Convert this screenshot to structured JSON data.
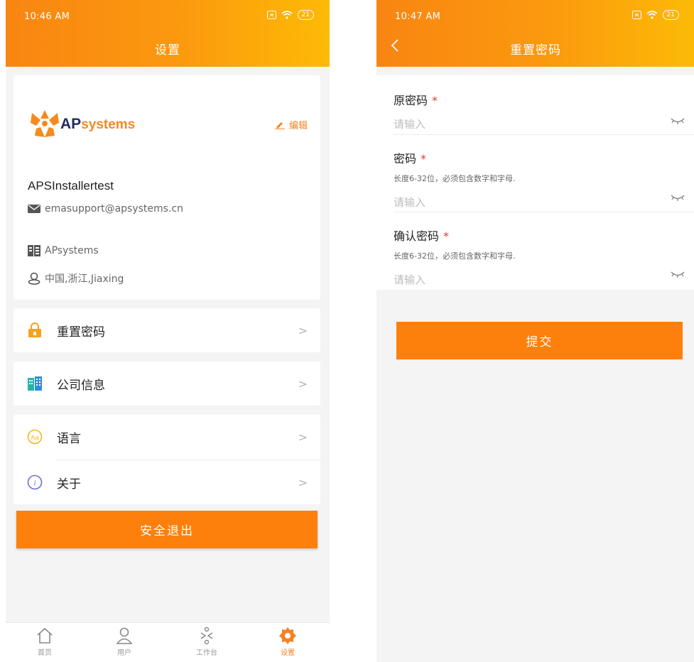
{
  "colors": {
    "accent": "#fd7f0c",
    "header_start": "#f98512",
    "header_end": "#fcba06",
    "required": "#e23b2e"
  },
  "left": {
    "status": {
      "time": "10:46 AM",
      "battery": "21"
    },
    "title": "设置",
    "profile": {
      "logo_text_bold": "AP",
      "logo_text_light": "systems",
      "edit_label": "编辑",
      "username": "APSInstallertest",
      "email": "emasupport@apsystems.cn",
      "company": "APsystems",
      "location": "中国,浙江,Jiaxing"
    },
    "menu": [
      {
        "label": "重置密码",
        "icon": "lock-icon"
      },
      {
        "label": "公司信息",
        "icon": "building-icon"
      },
      {
        "label": "语言",
        "icon": "language-icon"
      },
      {
        "label": "关于",
        "icon": "info-icon"
      }
    ],
    "logout_label": "安全退出",
    "tabs": [
      {
        "label": "首页",
        "icon": "home-icon"
      },
      {
        "label": "用户",
        "icon": "user-icon"
      },
      {
        "label": "工作台",
        "icon": "workbench-icon"
      },
      {
        "label": "设置",
        "icon": "settings-icon",
        "active": true
      }
    ]
  },
  "right": {
    "status": {
      "time": "10:47 AM",
      "battery": "21"
    },
    "title": "重置密码",
    "fields": [
      {
        "label": "原密码",
        "required_mark": "*",
        "hint": "",
        "placeholder": "请输入"
      },
      {
        "label": "密码",
        "required_mark": "*",
        "hint": "长度6-32位，必须包含数字和字母.",
        "placeholder": "请输入"
      },
      {
        "label": "确认密码",
        "required_mark": "*",
        "hint": "长度6-32位，必须包含数字和字母.",
        "placeholder": "请输入"
      }
    ],
    "submit_label": "提交"
  }
}
